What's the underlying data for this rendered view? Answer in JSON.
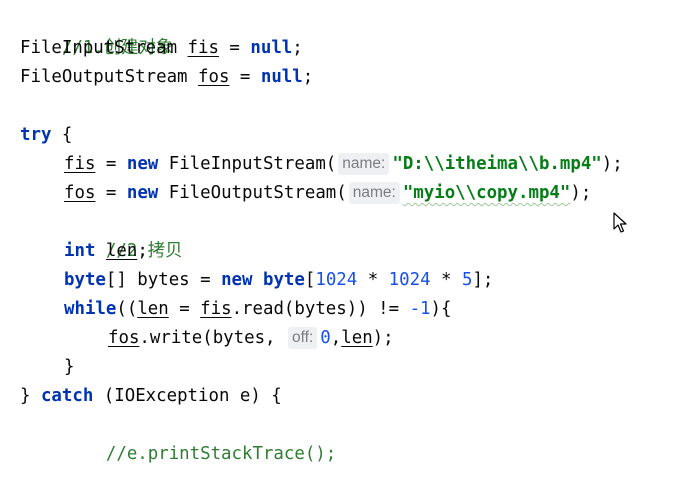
{
  "editor": {
    "lines": {
      "l1": {
        "comment": "//1.创建对象"
      },
      "l2": {
        "type": "FileInputStream ",
        "var": "fis",
        "rest": " = ",
        "kw": "null",
        "end": ";"
      },
      "l3": {
        "type": "FileOutputStream ",
        "var": "fos",
        "rest": " = ",
        "kw": "null",
        "end": ";"
      },
      "l5": {
        "kw": "try",
        "rest": " {"
      },
      "l6": {
        "var": "fis",
        "a": " = ",
        "kw": "new",
        "b": " FileInputStream(",
        "hint": "name:",
        "str": "\"D:\\\\itheima\\\\b.mp4\"",
        "end": ");"
      },
      "l7": {
        "var": "fos",
        "a": " = ",
        "kw": "new",
        "b": " FileOutputStream(",
        "hint": "name:",
        "str": "\"myio\\\\copy.mp4\"",
        "end": ");"
      },
      "l8": {
        "comment": "//2.拷贝"
      },
      "l9": {
        "kw": "int",
        "sp": " ",
        "var": "len",
        "end": ";"
      },
      "l10": {
        "kw1": "byte",
        "a": "[] bytes = ",
        "kw2": "new",
        "sp": " ",
        "kw3": "byte",
        "b": "[",
        "n1": "1024",
        "m1": " * ",
        "n2": "1024",
        "m2": " * ",
        "n3": "5",
        "end": "];"
      },
      "l11": {
        "kw": "while",
        "a": "((",
        "var1": "len",
        "b": " = ",
        "var2": "fis",
        "c": ".read(bytes)) != ",
        "n": "-1",
        "end": "){"
      },
      "l12": {
        "var": "fos",
        "a": ".write(bytes, ",
        "hint": "off:",
        "n": "0",
        "b": ",",
        "var2": "len",
        "end": ");"
      },
      "l13": {
        "text": "}"
      },
      "l14": {
        "a": "} ",
        "kw": "catch",
        "b": " (IOException e) {"
      },
      "l15": {
        "comment": "//e.printStackTrace();"
      }
    }
  }
}
